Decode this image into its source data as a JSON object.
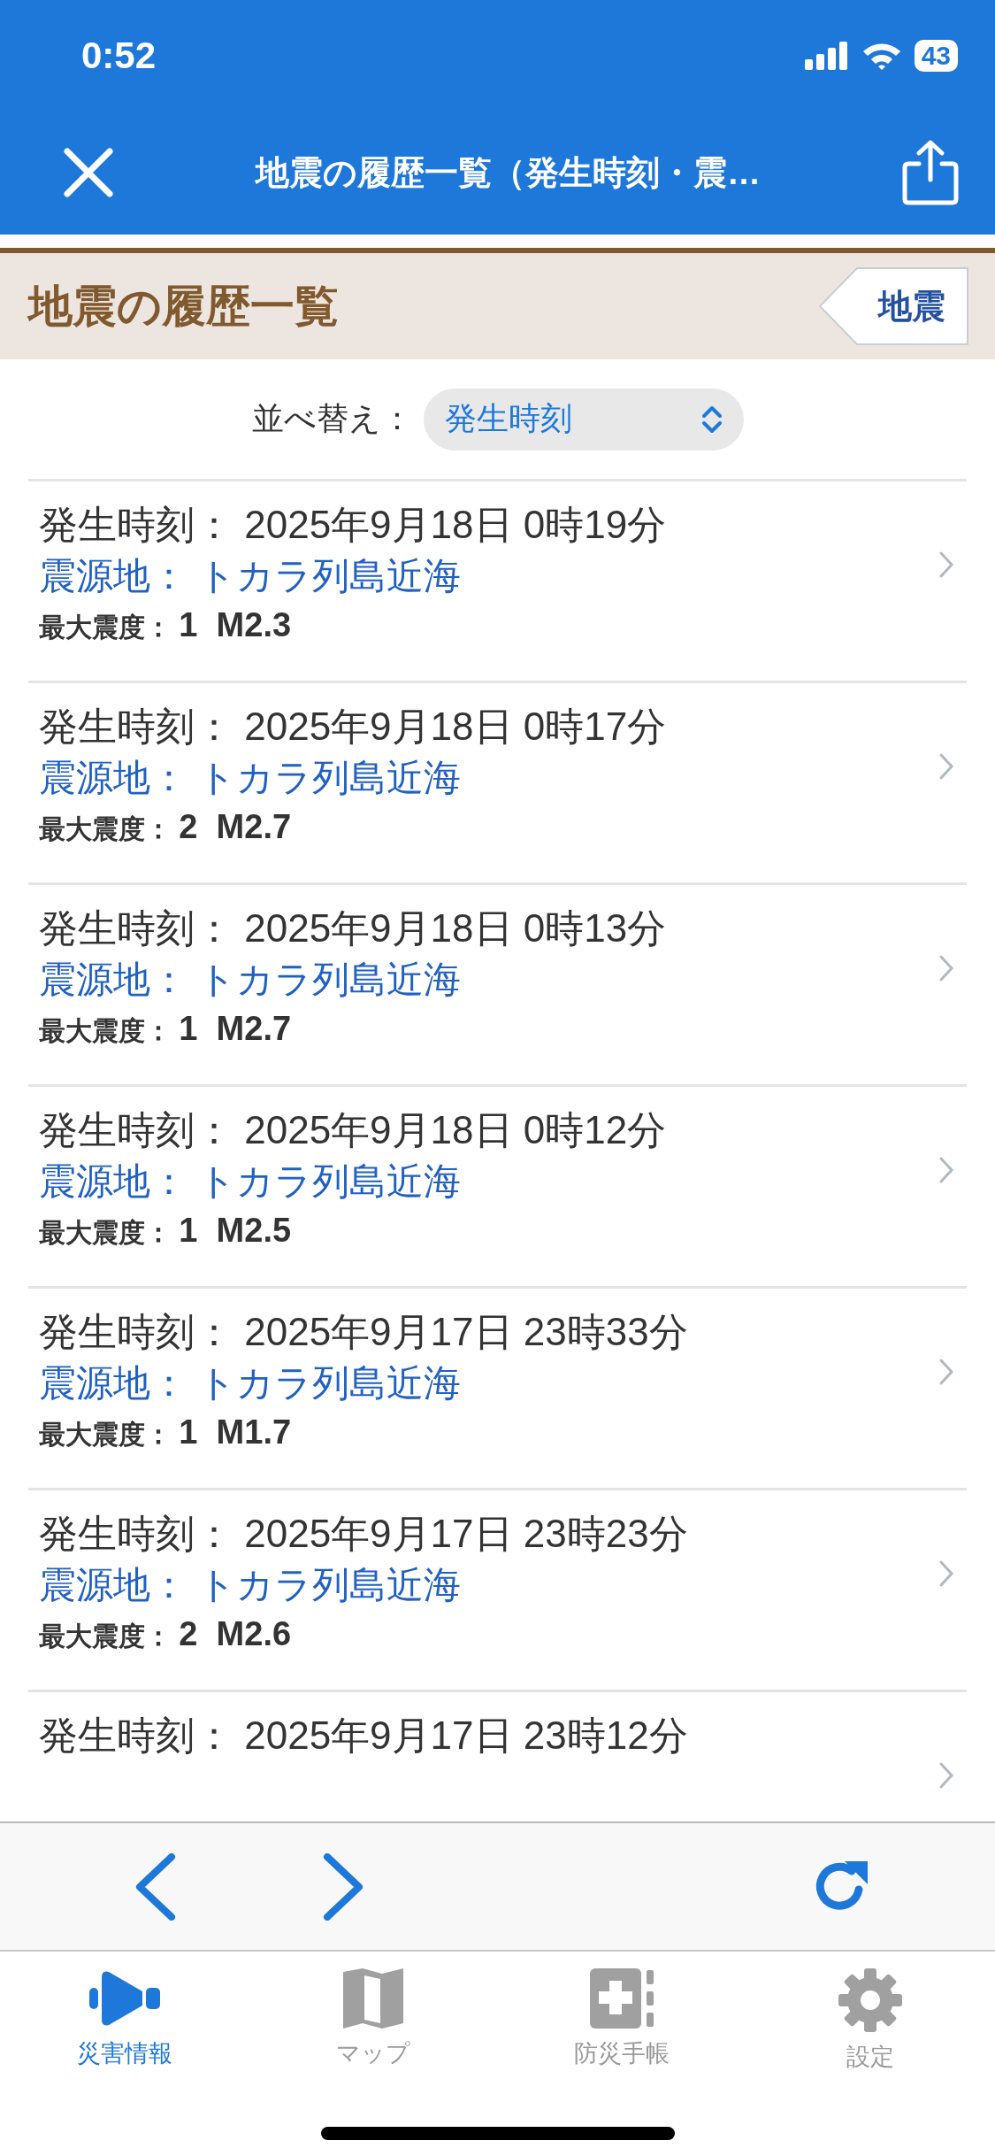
{
  "status_bar": {
    "time": "0:52",
    "battery": "43"
  },
  "header": {
    "title": "地震の履歴一覧（発生時刻・震…"
  },
  "section": {
    "title": "地震の履歴一覧",
    "back_label": "地震"
  },
  "sort": {
    "label": "並べ替え：",
    "value": "発生時刻"
  },
  "events": [
    {
      "time_label": "発生時刻：",
      "time": "2025年9月18日 0時19分",
      "place_label": "震源地：",
      "place": "トカラ列島近海",
      "intensity_label": "最大震度：",
      "intensity": "1",
      "magnitude": "M2.3"
    },
    {
      "time_label": "発生時刻：",
      "time": "2025年9月18日 0時17分",
      "place_label": "震源地：",
      "place": "トカラ列島近海",
      "intensity_label": "最大震度：",
      "intensity": "2",
      "magnitude": "M2.7"
    },
    {
      "time_label": "発生時刻：",
      "time": "2025年9月18日 0時13分",
      "place_label": "震源地：",
      "place": "トカラ列島近海",
      "intensity_label": "最大震度：",
      "intensity": "1",
      "magnitude": "M2.7"
    },
    {
      "time_label": "発生時刻：",
      "time": "2025年9月18日 0時12分",
      "place_label": "震源地：",
      "place": "トカラ列島近海",
      "intensity_label": "最大震度：",
      "intensity": "1",
      "magnitude": "M2.5"
    },
    {
      "time_label": "発生時刻：",
      "time": "2025年9月17日 23時33分",
      "place_label": "震源地：",
      "place": "トカラ列島近海",
      "intensity_label": "最大震度：",
      "intensity": "1",
      "magnitude": "M1.7"
    },
    {
      "time_label": "発生時刻：",
      "time": "2025年9月17日 23時23分",
      "place_label": "震源地：",
      "place": "トカラ列島近海",
      "intensity_label": "最大震度：",
      "intensity": "2",
      "magnitude": "M2.6"
    },
    {
      "time_label": "発生時刻：",
      "time": "2025年9月17日 23時12分"
    }
  ],
  "tab_bar": [
    {
      "kind": "megaphone",
      "label": "災害情報",
      "selected": true
    },
    {
      "kind": "map",
      "label": "マップ",
      "selected": false
    },
    {
      "kind": "notebook",
      "label": "防災手帳",
      "selected": false
    },
    {
      "kind": "gear",
      "label": "設定",
      "selected": false
    }
  ]
}
